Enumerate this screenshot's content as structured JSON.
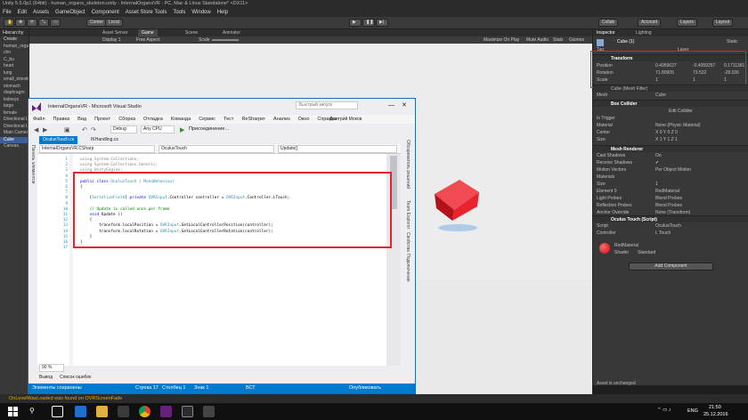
{
  "unity": {
    "title": "Unity 5.5.0p1 (64bit) - human_organs_skeleton.unity - InternalOrgansVR - PC, Mac & Linux Standalone* <DX11>",
    "menu": [
      "File",
      "Edit",
      "Assets",
      "GameObject",
      "Component",
      "Asset Store Tools",
      "Tools",
      "Window",
      "Help"
    ],
    "toolbar": {
      "center": "Center",
      "local": "Local",
      "collab": "Collab",
      "account": "Account",
      "layers": "Layers",
      "layout": "Layout"
    },
    "hierarchy": {
      "header": "Hierarchy",
      "create": "Create",
      "items": [
        "human_organs_skeleton",
        "chn",
        "C_bu",
        "heart",
        "lung",
        "small_intestine",
        "stomach",
        "diaphragm",
        "kidneys",
        "large",
        "female",
        "Directional Light",
        "Directional Light",
        "Main Camera",
        "Cube",
        "Canvas"
      ],
      "selected_index": 14
    },
    "scene": {
      "tabs": [
        "Asset Server",
        "Game",
        "Scene",
        "Animator"
      ],
      "display": "Display 1",
      "aspect": "Free Aspect",
      "scale_label": "Scale",
      "right_items": [
        "Maximize On Play",
        "Mute Audio",
        "Stats",
        "Gizmos"
      ]
    },
    "inspector": {
      "tabs": [
        "Inspector",
        "Lighting"
      ],
      "object_name": "Cube (1)",
      "static": "Static",
      "tag_label": "Tag",
      "layer_label": "Layer",
      "transform": {
        "title": "Transform",
        "position": {
          "label": "Position",
          "x": "0.4959627",
          "y": "-0.4059257",
          "z": "0.1711381"
        },
        "rotation": {
          "label": "Rotation",
          "x": "71.80905",
          "y": "73.522",
          "z": "-28.026"
        },
        "scale": {
          "label": "Scale",
          "x": "1",
          "y": "1",
          "z": "1"
        }
      },
      "mesh_filter": {
        "title": "Cube (Mesh Filter)",
        "mesh_label": "Mesh",
        "mesh_value": "Cube"
      },
      "box_collider": {
        "title": "Box Collider",
        "edit": "Edit Collider",
        "rows": [
          {
            "label": "Is Trigger",
            "value": ""
          },
          {
            "label": "Material",
            "value": "None (Physic Material)"
          },
          {
            "label": "Center",
            "value": "X 0   Y 0   Z 0"
          },
          {
            "label": "Size",
            "value": "X 1   Y 1   Z 1"
          }
        ]
      },
      "mesh_renderer": {
        "title": "Mesh Renderer",
        "rows": [
          {
            "label": "Cast Shadows",
            "value": "On"
          },
          {
            "label": "Receive Shadows",
            "value": "✔"
          },
          {
            "label": "Motion Vectors",
            "value": "Per Object Motion"
          },
          {
            "label": "Materials",
            "value": ""
          },
          {
            "label": "Size",
            "value": "1"
          },
          {
            "label": "Element 0",
            "value": "RedMaterial"
          },
          {
            "label": "Light Probes",
            "value": "Blend Probes"
          },
          {
            "label": "Reflection Probes",
            "value": "Blend Probes"
          },
          {
            "label": "Anchor Override",
            "value": "None (Transform)"
          }
        ]
      },
      "oculus_touch": {
        "title": "Oculus Touch (Script)",
        "rows": [
          {
            "label": "Script",
            "value": "OculusTouch"
          },
          {
            "label": "Controller",
            "value": "L Touch"
          }
        ]
      },
      "material": {
        "name": "RedMaterial",
        "shader_label": "Shader",
        "shader_value": "Standard"
      },
      "add_component": "Add Component",
      "asset_status": "Asset is unchanged"
    },
    "status_message": "OnLevelWasLoaded was found on OVRScreenFade"
  },
  "vs": {
    "title": "InternalOrgansVR - Microsoft Visual Studio",
    "quick_launch": "Быстрый запуск",
    "user": "Дмитрий Моков",
    "menu": [
      "Файл",
      "Правка",
      "Вид",
      "Проект",
      "Сборка",
      "Отладка",
      "Команда",
      "Сервис",
      "Тест",
      "ReSharper",
      "Анализ",
      "Окно",
      "Справка"
    ],
    "toolbar": {
      "config": "Debug",
      "platform": "Any CPU",
      "attach": "Присоединение..."
    },
    "tabs": [
      "OculusTouch.cs",
      "IKHandling.cs"
    ],
    "nav": {
      "project": "InternalOrgansVR.CSharp",
      "class": "OculusTouch",
      "member": "Update()"
    },
    "left_label": "Панель элементов",
    "right_labels": [
      "Обозреватель решений",
      "Team Explorer",
      "Свойства",
      "Подключение"
    ],
    "code": [
      {
        "n": "1",
        "text": "using System.Collections;"
      },
      {
        "n": "2",
        "text": "using System.Collections.Generic;"
      },
      {
        "n": "3",
        "text": "using UnityEngine;"
      },
      {
        "n": "4",
        "text": ""
      },
      {
        "n": "5",
        "text": "public class OculusTouch : MonoBehaviour"
      },
      {
        "n": "6",
        "text": "{"
      },
      {
        "n": "7",
        "text": ""
      },
      {
        "n": "8",
        "text": "    [SerializeField] private OVRInput.Controller controller = OVRInput.Controller.LTouch;"
      },
      {
        "n": "9",
        "text": ""
      },
      {
        "n": "10",
        "text": "    // Update is called once per frame"
      },
      {
        "n": "11",
        "text": "    void Update ()"
      },
      {
        "n": "12",
        "text": "    {"
      },
      {
        "n": "13",
        "text": "        transform.localPosition = OVRInput.GetLocalControllerPosition(controller);"
      },
      {
        "n": "14",
        "text": "        transform.localRotation = OVRInput.GetLocalControllerRotation(controller);"
      },
      {
        "n": "15",
        "text": "    }"
      },
      {
        "n": "16",
        "text": "}"
      },
      {
        "n": "17",
        "text": ""
      }
    ],
    "zoom": "90 %",
    "bottom_tabs": [
      "Вывод",
      "Список ошибок"
    ],
    "status": {
      "saved": "Элементы сохранены",
      "line": "Строка 17",
      "col": "Столбец 1",
      "char": "Знак 1",
      "mode": "ВСТ",
      "publish": "Опубликовать"
    }
  },
  "taskbar": {
    "lang": "ENG",
    "time": "21:50",
    "date": "25.12.2016"
  },
  "colors": {
    "highlight": "#e3242b",
    "cube": "#e8232e",
    "vs_accent": "#007acc"
  }
}
